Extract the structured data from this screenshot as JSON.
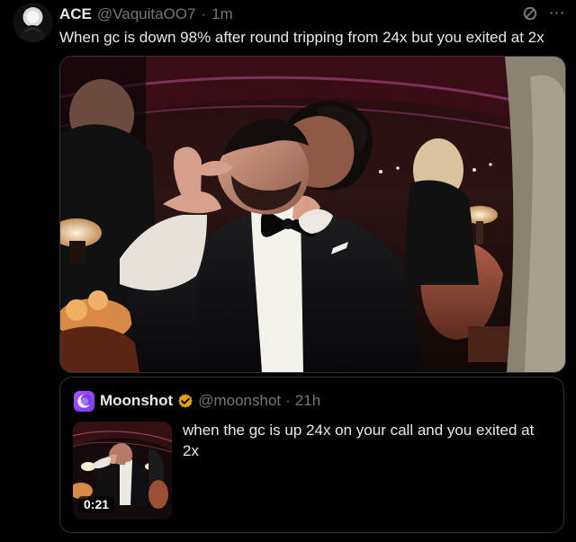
{
  "post": {
    "author_name": "ACE",
    "handle": "@VaquitaOO7",
    "separator": "·",
    "time": "1m",
    "text": "When gc is down 98% after round tripping from 24x but you exited at 2x",
    "icons": {
      "not_interested": "no-icon",
      "more": "more-icon"
    }
  },
  "quote": {
    "author_name": "Moonshot",
    "handle": "@moonshot",
    "separator": "·",
    "time": "21h",
    "text": "when the gc is up 24x on your call and you exited at 2x",
    "video_duration": "0:21",
    "badge_color": "#e5a400",
    "avatar_color": "#8b5cf6"
  }
}
